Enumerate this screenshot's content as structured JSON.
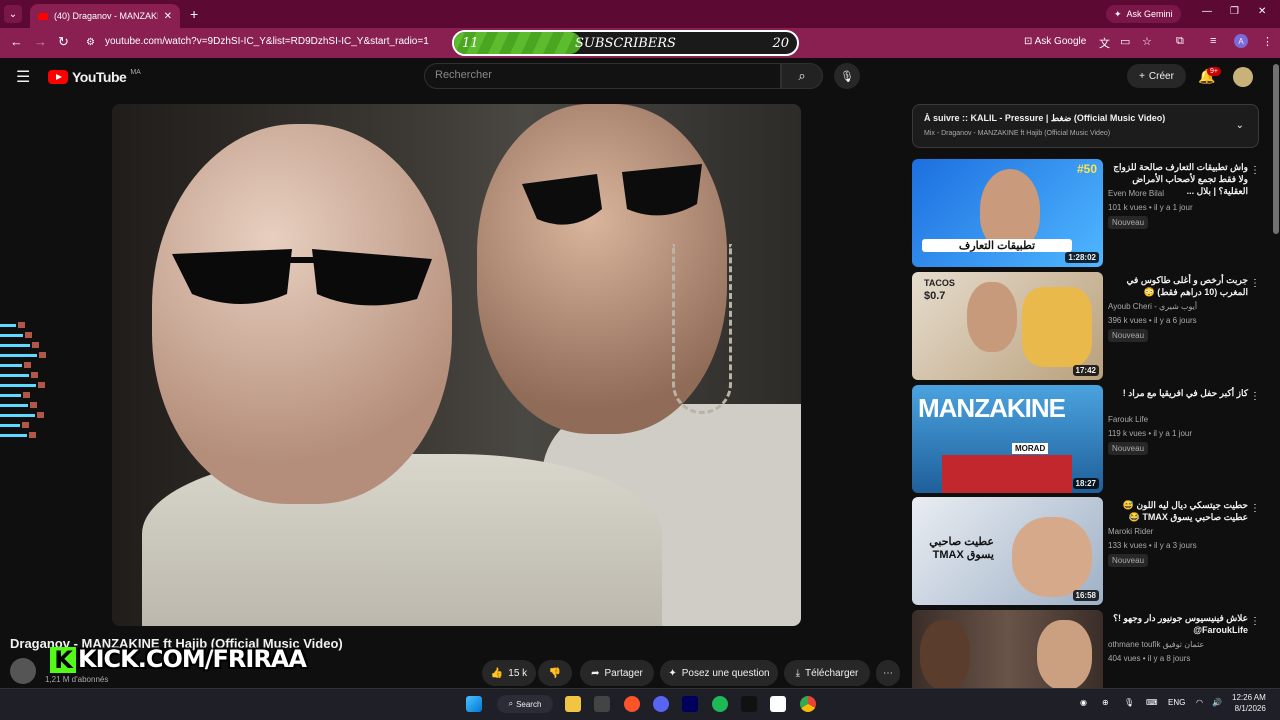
{
  "browser": {
    "tab_title": "(40) Draganov - MANZAKINE ft",
    "ask_gemini": "Ask Gemini",
    "url": "youtube.com/watch?v=9DzhSI-IC_Y&list=RD9DzhSI-IC_Y&start_radio=1",
    "ask_google": "Ask Google",
    "account_initial": "A"
  },
  "subscriber_goal": {
    "start": "11",
    "label": "SUBSCRIBERS",
    "end": "20",
    "progress_percent": 37
  },
  "youtube": {
    "logo": "YouTube",
    "country": "MA",
    "search_placeholder": "Rechercher",
    "create_label": "Créer",
    "notif_count": "9+"
  },
  "video": {
    "title": "Draganov - MANZAKINE ft Hajib (Official Music Video)",
    "subscribers": "1,21 M d'abonnés",
    "likes": "15 k",
    "share": "Partager",
    "ask": "Posez une question",
    "download": "Télécharger"
  },
  "overlay": {
    "kick": "KICK.COM/FRIRAA",
    "kick_icon": "K"
  },
  "up_next": {
    "title": "À suivre :: KALIL - Pressure | ضغط (Official Music Video)",
    "subtitle": "Mix - Draganov - MANZAKINE ft Hajib (Official Music Video)"
  },
  "recommendations": [
    {
      "title": "واش تطبيقات التعارف صالحة للزواج ولا فقط تجمع لأصحاب الأمراض العقلية؟ | بلال ...",
      "channel": "Even More Bilal",
      "meta": "101 k vues • il y a 1 jour",
      "badge": "Nouveau",
      "duration": "1:28:02"
    },
    {
      "title": "جربت أرخص و أغلى طاكوس في المغرب (10 دراهم فقط) 😳",
      "channel": "Ayoub Cheri - أيوب شيري",
      "meta": "396 k vues • il y a 6 jours",
      "badge": "Nouveau",
      "duration": "17:42"
    },
    {
      "title": "كاز أكبر حفل في افريقيا مع مراد !",
      "channel": "Farouk Life",
      "meta": "119 k vues • il y a 1 jour",
      "badge": "Nouveau",
      "duration": "18:27"
    },
    {
      "title": "حطيت جيتسكي ديال ليه اللون 😅 عطيت صاحبي يسوق TMAX 😂",
      "channel": "Maroki Rider",
      "meta": "133 k vues • il y a 3 jours",
      "badge": "Nouveau",
      "duration": "16:58"
    },
    {
      "title": "علاش فينيسيوس جونيور دار وجهو !؟ FaroukLife@",
      "channel": "othmane toufik عثمان توفيق",
      "meta": "404 vues • il y a 8 jours",
      "badge": "",
      "duration": ""
    }
  ],
  "thumb_texts": {
    "t1_episode": "#50",
    "t1_main": "تطبيقات التعارف",
    "t2_label": "TACOS",
    "t2_price": "$0.7",
    "t3_main": "MANZAKINE",
    "t3_tag": "MORAD",
    "t4_main": "عطيت صاحبي يسوق TMAX"
  },
  "taskbar": {
    "search": "Search",
    "lang": "ENG",
    "time": "12:26 AM",
    "date": "8/1/2026"
  },
  "colors": {
    "accent": "#5dbb2e",
    "browser_frame": "#8a1f52",
    "youtube_red": "#ff0000",
    "kick_green": "#53fc18"
  }
}
